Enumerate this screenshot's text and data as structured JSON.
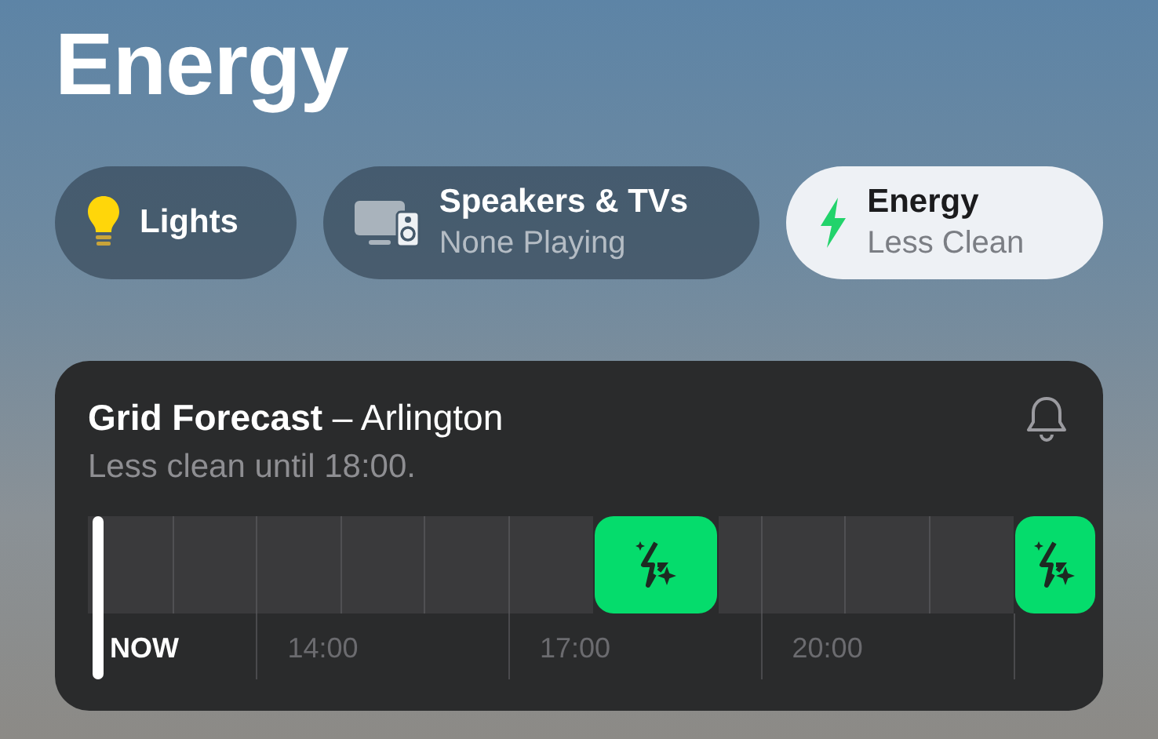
{
  "title": "Energy",
  "tabs": [
    {
      "kind": "lights",
      "label": "Lights",
      "selected": false
    },
    {
      "kind": "speakers",
      "label": "Speakers & TVs",
      "subtitle": "None Playing",
      "selected": false
    },
    {
      "kind": "energy",
      "label": "Energy",
      "subtitle": "Less Clean",
      "selected": true
    }
  ],
  "card": {
    "title": "**Grid Forecast** – Arlington",
    "subtitle": "Less clean until 18:00.",
    "slots": [
      {
        "clean": false
      },
      {
        "clean": false
      },
      {
        "clean": false
      },
      {
        "clean": false
      },
      {
        "clean": false
      },
      {
        "clean": false
      },
      {
        "clean": false
      },
      {
        "clean": false
      },
      {
        "clean": false
      },
      {
        "clean": false
      },
      {
        "clean": false
      },
      {
        "clean": false
      },
      {
        "clean": true
      },
      {
        "clean": true
      },
      {
        "clean": true
      },
      {
        "clean": false
      },
      {
        "clean": false
      },
      {
        "clean": false
      },
      {
        "clean": false
      },
      {
        "clean": false
      },
      {
        "clean": false
      },
      {
        "clean": false
      },
      {
        "clean": true
      },
      {
        "clean": true
      }
    ],
    "axis_labels": [
      {
        "kind": "now",
        "text": "NOW"
      },
      {
        "kind": "time",
        "text": "14:00"
      },
      {
        "kind": "time",
        "text": "17:00"
      },
      {
        "kind": "time",
        "text": "20:00"
      }
    ]
  }
}
